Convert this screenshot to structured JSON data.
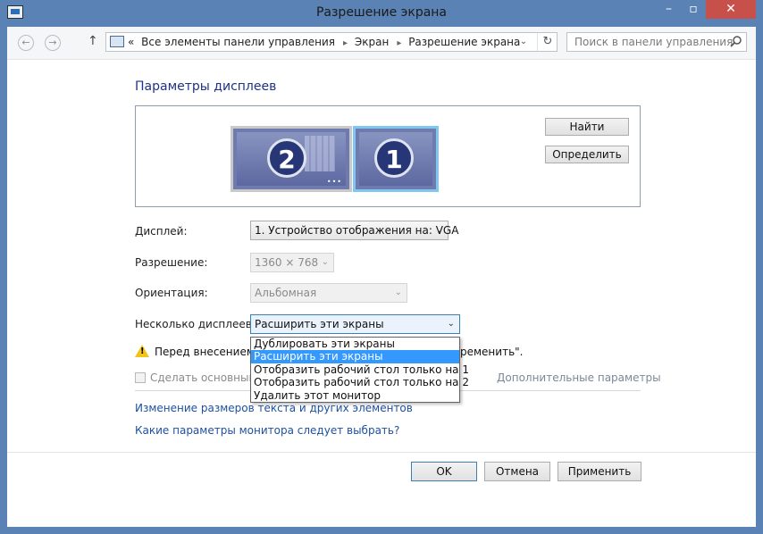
{
  "window": {
    "title": "Разрешение экрана",
    "minimize_glyph": "–",
    "maximize_glyph": "▫",
    "close_glyph": "✕"
  },
  "nav": {
    "back_glyph": "←",
    "forward_glyph": "→",
    "up_glyph": "↑"
  },
  "address": {
    "chevrons": "«",
    "crumbs": [
      "Все элементы панели управления",
      "Экран",
      "Разрешение экрана"
    ],
    "separator": "▸",
    "dropdown_glyph": "⌄",
    "refresh_glyph": "↻"
  },
  "search": {
    "placeholder": "Поиск в панели управления"
  },
  "page": {
    "heading": "Параметры дисплеев"
  },
  "preview": {
    "monitor_2_label": "2",
    "monitor_1_label": "1",
    "dots": "•••",
    "find_button": "Найти",
    "identify_button": "Определить"
  },
  "settings": {
    "display_label": "Дисплей:",
    "display_value": "1. Устройство отображения на: VGA",
    "resolution_label": "Разрешение:",
    "resolution_value": "1360 × 768",
    "orientation_label": "Ориентация:",
    "orientation_value": "Альбомная",
    "multi_label": "Несколько дисплеев:",
    "multi_value": "Расширить эти экраны",
    "multi_options": [
      "Дублировать эти экраны",
      "Расширить эти экраны",
      "Отобразить рабочий стол только на 1",
      "Отобразить рабочий стол только на 2",
      "Удалить этот монитор"
    ],
    "selected_option_index": 1,
    "arrow_glyph": "⌄"
  },
  "warning": {
    "text_visible": "Перед внесением д",
    "text_tail": "ременить\"."
  },
  "checkbox": {
    "label": "Сделать основным д",
    "checked": false
  },
  "links": {
    "advanced": "Дополнительные параметры",
    "text_size": "Изменение размеров текста и других элементов",
    "which_settings": "Какие параметры монитора следует выбрать?"
  },
  "footer": {
    "ok": "OK",
    "cancel": "Отмена",
    "apply": "Применить"
  },
  "colors": {
    "frame": "#5b82b5",
    "close_button": "#c7504a",
    "heading": "#1e3287",
    "link": "#1e50a0",
    "selection": "#3399ff",
    "monitor_fill": "#6f7aae",
    "monitor_badge": "#273677"
  }
}
